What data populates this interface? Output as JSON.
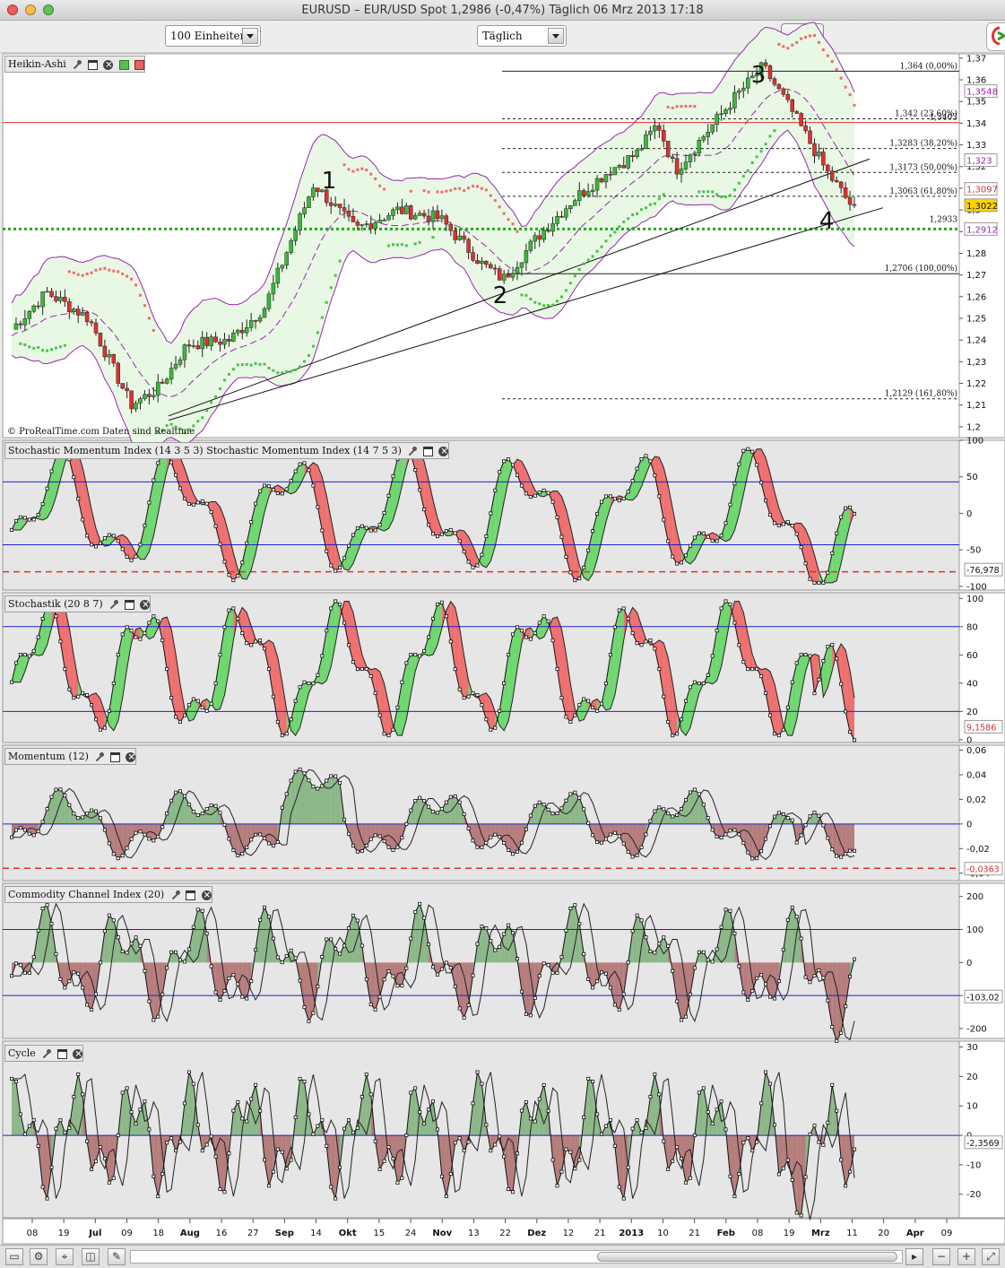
{
  "window": {
    "title": "EURUSD – EUR/USD Spot    1,2986 (-0,47%)    Täglich  06 Mrz 2013 17:18"
  },
  "toolbar": {
    "units": "100 Einheiten",
    "period": "Täglich"
  },
  "panels": {
    "price": {
      "label": "Heikin-Ashi",
      "credit": "© ProRealTime.com  Daten sind Realtime",
      "yticks": [
        "1,37",
        "1,36",
        "1,35",
        "1,34",
        "1,33",
        "1,32",
        "1,31",
        "1,3",
        "1,29",
        "1,28",
        "1,27",
        "1,26",
        "1,25",
        "1,24",
        "1,23",
        "1,22",
        "1,21",
        "1,2"
      ],
      "fib": [
        "1,364 (0,00%)",
        "1,342 (23,60%)",
        "1,3283 (38,20%)",
        "1,3173 (50,00%)",
        "1,3063 (61,80%)",
        "1,2706 (100,00%)",
        "1,2129 (161,80%)"
      ],
      "extra_level": "1,2933",
      "red_level_label": "1,3403",
      "waves": [
        "1",
        "2",
        "3",
        "4"
      ],
      "badges": [
        "1,3548",
        "1,323",
        "1,3097",
        "1,3022",
        "1,2912"
      ]
    },
    "smi": {
      "label": "Stochastic Momentum Index (14 3 5 3) Stochastic Momentum Index (14 7 5 3)",
      "yticks": [
        "100",
        "50",
        "0",
        "-50",
        "-100"
      ],
      "badge": "-76,978"
    },
    "stoch": {
      "label": "Stochastik (20 8 7)",
      "yticks": [
        "100",
        "80",
        "60",
        "40",
        "20",
        "0"
      ],
      "badge": "9,1586"
    },
    "mom": {
      "label": "Momentum (12)",
      "yticks": [
        "0,06",
        "0,04",
        "0,02",
        "0",
        "-0,02",
        "-0,04"
      ],
      "badge": "-0,0363"
    },
    "cci": {
      "label": "Commodity Channel Index (20)",
      "yticks": [
        "200",
        "100",
        "0",
        "-100",
        "-200"
      ],
      "badge": "-103,02"
    },
    "cycle": {
      "label": "Cycle",
      "yticks": [
        "30",
        "20",
        "10",
        "0",
        "-10",
        "-20"
      ],
      "badge": "-2,3569"
    }
  },
  "xaxis": [
    "08",
    "19",
    "Jul",
    "09",
    "18",
    "Aug",
    "16",
    "27",
    "Sep",
    "14",
    "Okt",
    "15",
    "24",
    "Nov",
    "13",
    "22",
    "Dez",
    "12",
    "21",
    "2013",
    "10",
    "21",
    "Feb",
    "08",
    "19",
    "Mrz",
    "11",
    "20",
    "Apr",
    "09"
  ],
  "colors": {
    "bull": "#3cb83c",
    "bear": "#e03030",
    "band": "#9c27b0",
    "fill": "#e8f8e4",
    "hline": "#2020cc",
    "red": "#e03030"
  },
  "statusbar": {
    "left_icon": "folder-icon",
    "zoom_out": "zoom-out-icon",
    "zoom_in": "zoom-in-icon"
  }
}
